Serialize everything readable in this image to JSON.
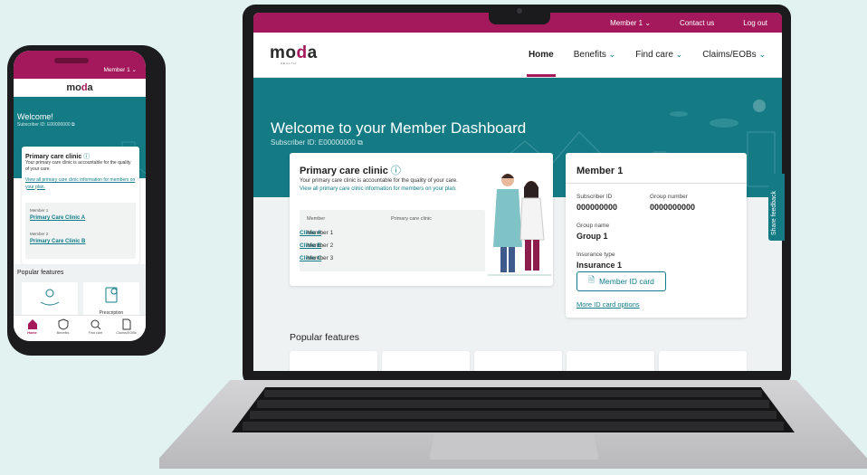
{
  "brand": {
    "logo_text_1": "mo",
    "logo_text_2": "d",
    "logo_text_3": "a",
    "logo_subtext": "HEALTH",
    "accent_color": "#a3195b",
    "teal_color": "#147b85",
    "link_color": "#0f7c89"
  },
  "topbar": {
    "member_label": "Member 1",
    "contact_label": "Contact us",
    "logout_label": "Log out"
  },
  "nav": {
    "items": [
      {
        "label": "Home",
        "active": true,
        "has_dropdown": false
      },
      {
        "label": "Benefits",
        "has_dropdown": true
      },
      {
        "label": "Find care",
        "has_dropdown": true
      },
      {
        "label": "Claims/EOBs",
        "has_dropdown": true
      }
    ]
  },
  "hero": {
    "title": "Welcome to your Member Dashboard",
    "subscriber_id": "Subscriber ID: E00000000"
  },
  "primary_care": {
    "title": "Primary care clinic",
    "description": "Your primary care clinic is accountable for the quality of your care.",
    "link_text": "View all primary care clinic information for members on your plan.",
    "col_member": "Member",
    "col_clinic": "Primary care clinic",
    "rows": [
      {
        "member": "Member 1",
        "clinic": "Clinic A"
      },
      {
        "member": "Member 2",
        "clinic": "Clinic B"
      },
      {
        "member": "Member 3",
        "clinic": "Clinic C"
      }
    ]
  },
  "member_card": {
    "title": "Member 1",
    "subscriber_id_label": "Subscriber ID",
    "subscriber_id_value": "000000000",
    "group_number_label": "Group number",
    "group_number_value": "0000000000",
    "group_name_label": "Group name",
    "group_name_value": "Group 1",
    "insurance_type_label": "Insurance type",
    "insurance_type_value": "Insurance 1",
    "id_card_button": "Member ID card",
    "more_options_link": "More ID card options"
  },
  "feedback_tab": "Share feedback",
  "popular": {
    "title": "Popular features"
  },
  "phone": {
    "member_label": "Member 1",
    "welcome": "Welcome!",
    "subscriber_id": "Subscriber ID: E00000000",
    "pcc_title": "Primary care clinic",
    "pcc_desc": "Your primary care clinic is accountable for the quality of your care.",
    "pcc_link": "View all primary care clinic information for members on your plan.",
    "members": [
      {
        "label": "Member 1",
        "clinic": "Primary Care Clinic A"
      },
      {
        "label": "Member 2",
        "clinic": "Primary Care Clinic B"
      }
    ],
    "popular_title": "Popular features",
    "feature_label": "Prescription",
    "tabs": [
      {
        "label": "Home",
        "icon": "home-icon",
        "active": true
      },
      {
        "label": "Benefits",
        "icon": "shield-icon"
      },
      {
        "label": "Find care",
        "icon": "search-icon"
      },
      {
        "label": "Claims/EOBs",
        "icon": "document-icon"
      }
    ]
  }
}
